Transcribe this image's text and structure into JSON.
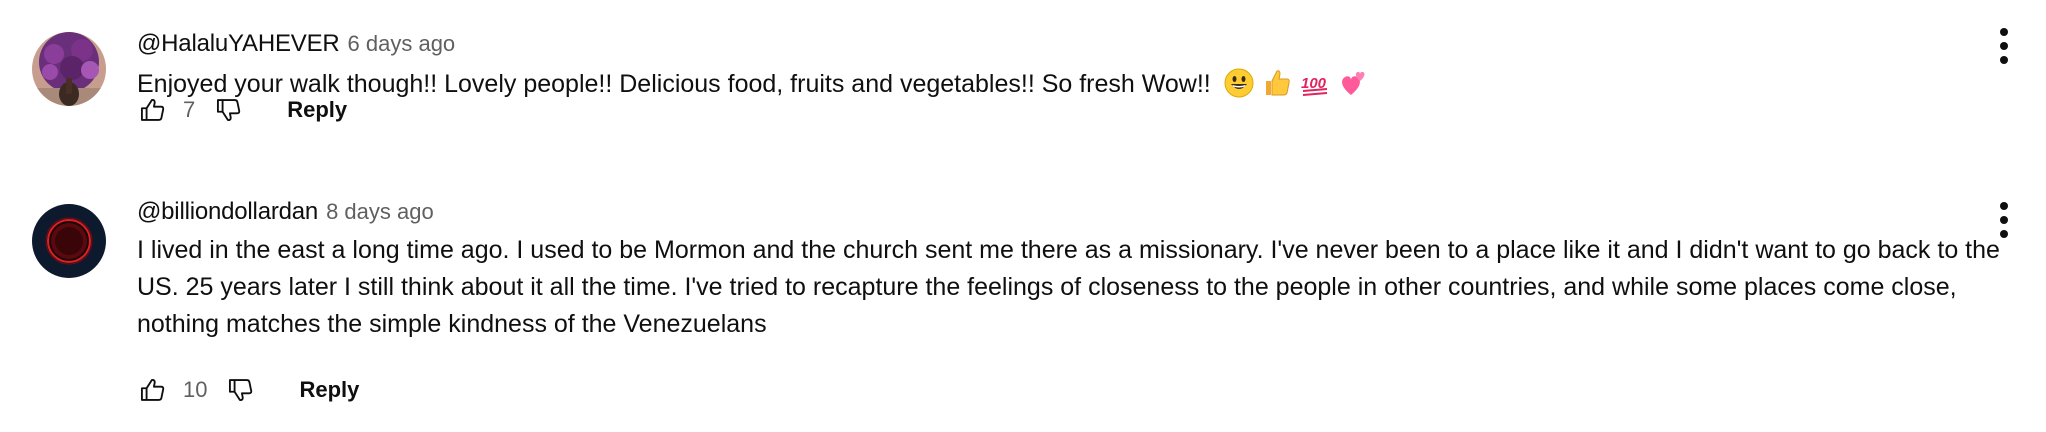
{
  "comments": [
    {
      "author": "@HalaluYAHEVER",
      "time": "6 days ago",
      "text": "Enjoyed your walk though!! Lovely people!! Delicious food, fruits and vegetables!! So fresh Wow!!",
      "emojis": [
        "grinning-face",
        "thumbs-up",
        "hundred-points",
        "two-hearts"
      ],
      "likes": "7",
      "reply_label": "Reply"
    },
    {
      "author": "@billiondollardan",
      "time": "8 days ago",
      "text": "I lived in the east a long time ago. I used to be Mormon and the church sent me there as a missionary. I've never been to a place like it and I didn't want to go back to the US. 25 years later I still think about it all the time. I've tried to recapture the feelings of closeness to the people in other countries, and while some places come close, nothing matches the simple kindness of the Venezuelans",
      "likes": "10",
      "reply_label": "Reply"
    }
  ],
  "colors": {
    "primary_text": "#0f0f0f",
    "secondary_text": "#606060",
    "background": "#ffffff"
  }
}
